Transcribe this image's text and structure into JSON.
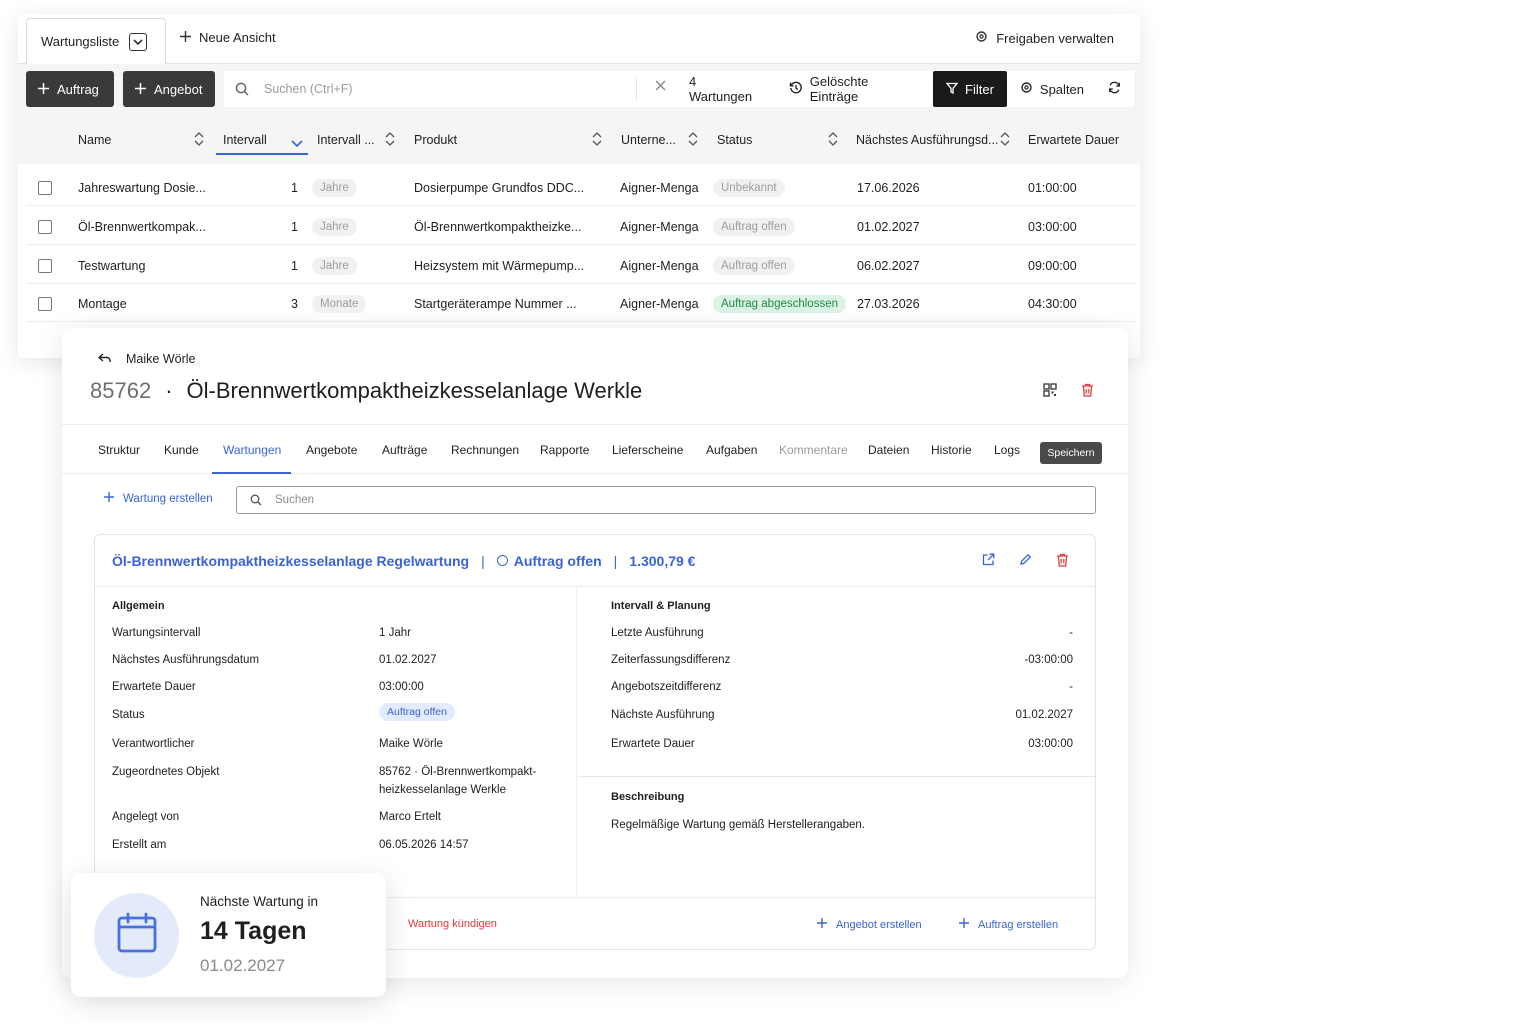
{
  "list_view": {
    "view_tab": "Wartungsliste",
    "new_view": "Neue Ansicht",
    "share": "Freigaben verwalten",
    "toolbar": {
      "order_button": "Auftrag",
      "offer_button": "Angebot",
      "search_placeholder": "Suchen (Ctrl+F)",
      "count": "4 Wartungen",
      "deleted": "Gelöschte Einträge",
      "filter": "Filter",
      "columns": "Spalten"
    },
    "columns": [
      "Name",
      "Intervall",
      "Intervall ...",
      "Produkt",
      "Unterne...",
      "Status",
      "Nächstes Ausführungsd...",
      "Erwartete Dauer"
    ],
    "rows": [
      {
        "name": "Jahreswartung Dosie...",
        "interval": "1",
        "unit": "Jahre",
        "product": "Dosierpumpe Grundfos DDC...",
        "company": "Aigner-Menga",
        "status": "Unbekannt",
        "status_style": "grey",
        "next": "17.06.2026",
        "duration": "01:00:00"
      },
      {
        "name": "Öl-Brennwertkompak...",
        "interval": "1",
        "unit": "Jahre",
        "product": "Öl-Brennwertkompaktheizke...",
        "company": "Aigner-Menga",
        "status": "Auftrag offen",
        "status_style": "grey",
        "next": "01.02.2027",
        "duration": "03:00:00"
      },
      {
        "name": "Testwartung",
        "interval": "1",
        "unit": "Jahre",
        "product": "Heizsystem mit Wärmepump...",
        "company": "Aigner-Menga",
        "status": "Auftrag offen",
        "status_style": "grey",
        "next": "06.02.2027",
        "duration": "09:00:00"
      },
      {
        "name": "Montage",
        "interval": "3",
        "unit": "Monate",
        "product": "Startgeräterampe Nummer ...",
        "company": "Aigner-Menga",
        "status": "Auftrag abgeschlossen",
        "status_style": "green",
        "next": "27.03.2026",
        "duration": "04:30:00"
      }
    ]
  },
  "detail": {
    "back_label": "Maike Wörle",
    "number": "85762",
    "separator": "·",
    "title": "Öl-Brennwertkompaktheizkesselanlage Werkle",
    "tabs": [
      "Struktur",
      "Kunde",
      "Wartungen",
      "Angebote",
      "Aufträge",
      "Rechnungen",
      "Rapporte",
      "Lieferscheine",
      "Aufgaben",
      "Kommentare",
      "Dateien",
      "Historie",
      "Logs"
    ],
    "active_tab": "Wartungen",
    "save": "Speichern",
    "create_maintenance": "Wartung erstellen",
    "search_placeholder": "Suchen",
    "card": {
      "name": "Öl-Brennwertkompaktheizkesselanlage Regelwartung",
      "divider": "|",
      "status": "Auftrag offen",
      "amount": "1.300,79 €",
      "general_title": "Allgemein",
      "general": [
        {
          "label": "Wartungsintervall",
          "value": "1 Jahr"
        },
        {
          "label": "Nächstes Ausführungsdatum",
          "value": "01.02.2027"
        },
        {
          "label": "Erwartete Dauer",
          "value": "03:00:00"
        },
        {
          "label": "Status",
          "value": "Auftrag offen"
        },
        {
          "label": "Verantwortlicher",
          "value": "Maike Wörle"
        },
        {
          "label": "Zugeordnetes Objekt",
          "value": "85762 · Öl-Brennwertkompakt-",
          "value2": "heizkesselanlage Werkle"
        },
        {
          "label": "Angelegt von",
          "value": "Marco Ertelt"
        },
        {
          "label": "Erstellt am",
          "value": "06.05.2026 14:57"
        }
      ],
      "planning_title": "Intervall & Planung",
      "planning": [
        {
          "label": "Letzte Ausführung",
          "value": "-"
        },
        {
          "label": "Zeiterfassungsdifferenz",
          "value": "-03:00:00"
        },
        {
          "label": "Angebotszeitdifferenz",
          "value": "-"
        },
        {
          "label": "Nächste Ausführung",
          "value": "01.02.2027"
        },
        {
          "label": "Erwartete Dauer",
          "value": "03:00:00"
        }
      ],
      "description_title": "Beschreibung",
      "description": "Regelmäßige Wartung gemäß Herstellerangaben.",
      "cancel": "Wartung kündigen",
      "create_offer": "Angebot erstellen",
      "create_order": "Auftrag erstellen"
    }
  },
  "reminder": {
    "label": "Nächste Wartung in",
    "days": "14 Tagen",
    "date": "01.02.2027"
  },
  "colors": {
    "accent": "#3a63d6",
    "danger": "#e03a3a",
    "success": "#1d8a4a",
    "dark_button": "#3a3a3a"
  }
}
